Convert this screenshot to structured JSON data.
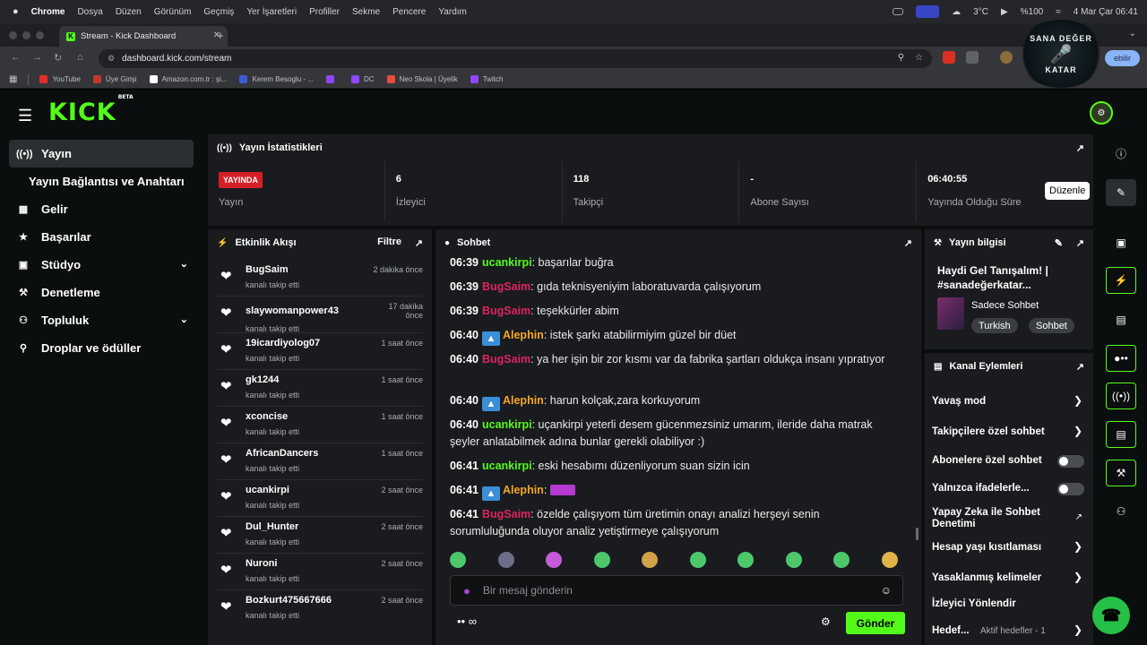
{
  "menubar": {
    "apple": "",
    "items": [
      "Chrome",
      "Dosya",
      "Düzen",
      "Görünüm",
      "Geçmiş",
      "Yer İşaretleri",
      "Profiller",
      "Sekme",
      "Pencere",
      "Yardım"
    ],
    "temp": "3°C",
    "battery": "%100",
    "datetime": "4 Mar Çar  06:41"
  },
  "browser": {
    "tab_title": "Stream - Kick Dashboard",
    "url": "dashboard.kick.com/stream",
    "profile_button": "ebilir",
    "bookmarks": [
      {
        "label": "YouTube",
        "color": "#e52d27"
      },
      {
        "label": "Üye Girişi",
        "color": "#c0392b"
      },
      {
        "label": "Amazon.com.tr : şi...",
        "color": "#ffffff"
      },
      {
        "label": "Kerem Besoglu - ...",
        "color": "#3b5bd6"
      },
      {
        "label": "",
        "color": "#9146ff"
      },
      {
        "label": "DC",
        "color": "#9146ff"
      },
      {
        "label": "Neo Skola | Üyelik",
        "color": "#e74c3c"
      },
      {
        "label": "Twitch",
        "color": "#9146ff"
      }
    ]
  },
  "header": {
    "logo": "KICK",
    "logo_badge": "BETA"
  },
  "watermark": {
    "top": "SANA DEĞER",
    "bottom": "KATAR"
  },
  "sidebar": {
    "items": [
      {
        "label": "Yayın",
        "icon": "broadcast-icon"
      },
      {
        "label": "Yayın Bağlantısı ve Anahtarı",
        "icon": ""
      },
      {
        "label": "Gelir",
        "icon": "revenue-icon"
      },
      {
        "label": "Başarılar",
        "icon": "trophy-icon"
      },
      {
        "label": "Stüdyo",
        "icon": "studio-icon"
      },
      {
        "label": "Denetleme",
        "icon": "wrench-icon"
      },
      {
        "label": "Topluluk",
        "icon": "community-icon"
      },
      {
        "label": "Droplar ve ödüller",
        "icon": "gift-icon"
      }
    ]
  },
  "stats": {
    "title": "Yayın İstatistikleri",
    "live_badge": "YAYINDA",
    "items": [
      {
        "value": "",
        "label": "Yayın"
      },
      {
        "value": "6",
        "label": "İzleyici"
      },
      {
        "value": "118",
        "label": "Takipçi"
      },
      {
        "value": "-",
        "label": "Abone Sayısı"
      },
      {
        "value": "06:40:55",
        "label": "Yayında Olduğu Süre"
      }
    ]
  },
  "activity": {
    "title": "Etkinlik Akışı",
    "filter": "Filtre",
    "items": [
      {
        "name": "BugSaim",
        "action": "kanalı takip etti",
        "time": "2 dakika önce"
      },
      {
        "name": "slaywomanpower43",
        "action": "kanalı takip etti",
        "time": "17 dakika önce"
      },
      {
        "name": "19icardiyolog07",
        "action": "kanalı takip etti",
        "time": "1 saat önce"
      },
      {
        "name": "gk1244",
        "action": "kanalı takip etti",
        "time": "1 saat önce"
      },
      {
        "name": "xconcise",
        "action": "kanalı takip etti",
        "time": "1 saat önce"
      },
      {
        "name": "AfricanDancers",
        "action": "kanalı takip etti",
        "time": "1 saat önce"
      },
      {
        "name": "ucankirpi",
        "action": "kanalı takip etti",
        "time": "2 saat önce"
      },
      {
        "name": "Dul_Hunter",
        "action": "kanalı takip etti",
        "time": "2 saat önce"
      },
      {
        "name": "Nuroni",
        "action": "kanalı takip etti",
        "time": "2 saat önce"
      },
      {
        "name": "Bozkurt475667666",
        "action": "kanalı takip etti",
        "time": "2 saat önce"
      }
    ]
  },
  "chat": {
    "title": "Sohbet",
    "messages": [
      {
        "time": "06:39",
        "user": "ucankirpi",
        "color": "#53fc18",
        "badge": false,
        "text": "başarılar buğra"
      },
      {
        "time": "06:39",
        "user": "BugSaim",
        "color": "#e0245e",
        "badge": false,
        "text": "gıda teknisyeniyim laboratuvarda çalışıyorum"
      },
      {
        "time": "06:39",
        "user": "BugSaim",
        "color": "#e0245e",
        "badge": false,
        "text": "teşekkürler abim"
      },
      {
        "time": "06:40",
        "user": "Alephin",
        "color": "#f5a623",
        "badge": true,
        "text": "istek şarkı atabilirmiyim güzel bir düet"
      },
      {
        "time": "06:40",
        "user": "BugSaim",
        "color": "#e0245e",
        "badge": false,
        "text": "ya her işin bir zor kısmı var da fabrika şartları oldukça insanı yıpratıyor"
      },
      {
        "time": "06:40",
        "user": "Alephin",
        "color": "#f5a623",
        "badge": true,
        "text": "harun kolçak,zara korkuyorum"
      },
      {
        "time": "06:40",
        "user": "ucankirpi",
        "color": "#53fc18",
        "badge": false,
        "text": "uçankirpi yeterli desem gücenmezsiniz umarım, ileride daha matrak şeyler anlatabilmek adına bunlar gerekli olabiliyor :)"
      },
      {
        "time": "06:41",
        "user": "ucankirpi",
        "color": "#53fc18",
        "badge": false,
        "text": "eski hesabımı düzenliyorum suan sizin icin"
      },
      {
        "time": "06:41",
        "user": "Alephin",
        "color": "#f5a623",
        "badge": true,
        "text": ""
      },
      {
        "time": "06:41",
        "user": "BugSaim",
        "color": "#e0245e",
        "badge": false,
        "text": "özelde çalışıyom tüm üretimin onayı analizi herşeyi senin sorumluluğunda oluyor analiz yetiştirmeye çalışıyorum"
      }
    ],
    "emotes": [
      "frog-emote",
      "face-emote",
      "clown-emote",
      "frog-emote",
      "cat-emote",
      "frog-emote",
      "frog-emote",
      "frog-emote",
      "frog-emote",
      "robot-emote"
    ],
    "placeholder": "Bir mesaj gönderin",
    "send": "Gönder"
  },
  "stream_info": {
    "title": "Yayın bilgisi",
    "stream_title": "Haydi Gel Tanışalım! | #sanadeğerkatar...",
    "category": "Sadece Sohbet",
    "tags": [
      "Turkish",
      "Sohbet"
    ]
  },
  "channel_actions": {
    "title": "Kanal Eylemleri",
    "items": [
      {
        "label": "Yavaş mod",
        "control": "chevron"
      },
      {
        "label": "Takipçilere özel sohbet",
        "control": "chevron"
      },
      {
        "label": "Abonelere özel sohbet",
        "control": "toggle"
      },
      {
        "label": "Yalnızca ifadelerle...",
        "control": "toggle"
      },
      {
        "label": "Yapay Zeka ile Sohbet Denetimi",
        "control": "external"
      },
      {
        "label": "Hesap yaşı kısıtlaması",
        "control": "chevron"
      },
      {
        "label": "Yasaklanmış kelimeler",
        "control": "chevron"
      },
      {
        "label": "İzleyici Yönlendir",
        "control": "none"
      },
      {
        "label": "Hedef...",
        "control": "chevron",
        "extra": "Aktif hedefler - 1"
      }
    ]
  },
  "rail": {
    "tooltip": "Düzenle"
  },
  "colors": {
    "accent": "#53fc18",
    "live": "#d51f27",
    "panel": "#191b1f",
    "background": "#0b0e0f"
  }
}
